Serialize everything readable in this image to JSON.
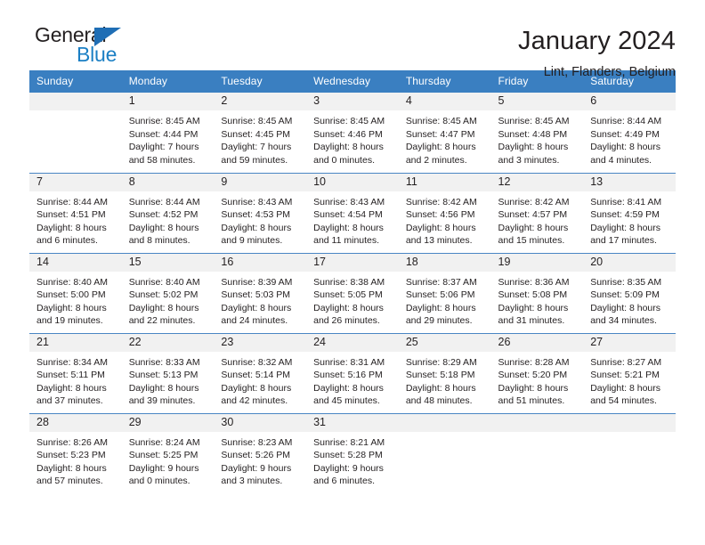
{
  "brand": {
    "name_top": "General",
    "name_bottom": "Blue",
    "flag_icon": "blue-triangle-flag-icon",
    "color_primary": "#1f6eb5",
    "color_secondary": "#1b7fc4"
  },
  "header": {
    "title": "January 2024",
    "subtitle": "Lint, Flanders, Belgium"
  },
  "calendar": {
    "header_bg": "#3a7fc1",
    "daynum_bg": "#f1f1f1",
    "row_divider": "#4a86c4",
    "weekdays": [
      "Sunday",
      "Monday",
      "Tuesday",
      "Wednesday",
      "Thursday",
      "Friday",
      "Saturday"
    ],
    "weeks": [
      [
        {
          "day": "",
          "lines": []
        },
        {
          "day": "1",
          "lines": [
            "Sunrise: 8:45 AM",
            "Sunset: 4:44 PM",
            "Daylight: 7 hours",
            "and 58 minutes."
          ]
        },
        {
          "day": "2",
          "lines": [
            "Sunrise: 8:45 AM",
            "Sunset: 4:45 PM",
            "Daylight: 7 hours",
            "and 59 minutes."
          ]
        },
        {
          "day": "3",
          "lines": [
            "Sunrise: 8:45 AM",
            "Sunset: 4:46 PM",
            "Daylight: 8 hours",
            "and 0 minutes."
          ]
        },
        {
          "day": "4",
          "lines": [
            "Sunrise: 8:45 AM",
            "Sunset: 4:47 PM",
            "Daylight: 8 hours",
            "and 2 minutes."
          ]
        },
        {
          "day": "5",
          "lines": [
            "Sunrise: 8:45 AM",
            "Sunset: 4:48 PM",
            "Daylight: 8 hours",
            "and 3 minutes."
          ]
        },
        {
          "day": "6",
          "lines": [
            "Sunrise: 8:44 AM",
            "Sunset: 4:49 PM",
            "Daylight: 8 hours",
            "and 4 minutes."
          ]
        }
      ],
      [
        {
          "day": "7",
          "lines": [
            "Sunrise: 8:44 AM",
            "Sunset: 4:51 PM",
            "Daylight: 8 hours",
            "and 6 minutes."
          ]
        },
        {
          "day": "8",
          "lines": [
            "Sunrise: 8:44 AM",
            "Sunset: 4:52 PM",
            "Daylight: 8 hours",
            "and 8 minutes."
          ]
        },
        {
          "day": "9",
          "lines": [
            "Sunrise: 8:43 AM",
            "Sunset: 4:53 PM",
            "Daylight: 8 hours",
            "and 9 minutes."
          ]
        },
        {
          "day": "10",
          "lines": [
            "Sunrise: 8:43 AM",
            "Sunset: 4:54 PM",
            "Daylight: 8 hours",
            "and 11 minutes."
          ]
        },
        {
          "day": "11",
          "lines": [
            "Sunrise: 8:42 AM",
            "Sunset: 4:56 PM",
            "Daylight: 8 hours",
            "and 13 minutes."
          ]
        },
        {
          "day": "12",
          "lines": [
            "Sunrise: 8:42 AM",
            "Sunset: 4:57 PM",
            "Daylight: 8 hours",
            "and 15 minutes."
          ]
        },
        {
          "day": "13",
          "lines": [
            "Sunrise: 8:41 AM",
            "Sunset: 4:59 PM",
            "Daylight: 8 hours",
            "and 17 minutes."
          ]
        }
      ],
      [
        {
          "day": "14",
          "lines": [
            "Sunrise: 8:40 AM",
            "Sunset: 5:00 PM",
            "Daylight: 8 hours",
            "and 19 minutes."
          ]
        },
        {
          "day": "15",
          "lines": [
            "Sunrise: 8:40 AM",
            "Sunset: 5:02 PM",
            "Daylight: 8 hours",
            "and 22 minutes."
          ]
        },
        {
          "day": "16",
          "lines": [
            "Sunrise: 8:39 AM",
            "Sunset: 5:03 PM",
            "Daylight: 8 hours",
            "and 24 minutes."
          ]
        },
        {
          "day": "17",
          "lines": [
            "Sunrise: 8:38 AM",
            "Sunset: 5:05 PM",
            "Daylight: 8 hours",
            "and 26 minutes."
          ]
        },
        {
          "day": "18",
          "lines": [
            "Sunrise: 8:37 AM",
            "Sunset: 5:06 PM",
            "Daylight: 8 hours",
            "and 29 minutes."
          ]
        },
        {
          "day": "19",
          "lines": [
            "Sunrise: 8:36 AM",
            "Sunset: 5:08 PM",
            "Daylight: 8 hours",
            "and 31 minutes."
          ]
        },
        {
          "day": "20",
          "lines": [
            "Sunrise: 8:35 AM",
            "Sunset: 5:09 PM",
            "Daylight: 8 hours",
            "and 34 minutes."
          ]
        }
      ],
      [
        {
          "day": "21",
          "lines": [
            "Sunrise: 8:34 AM",
            "Sunset: 5:11 PM",
            "Daylight: 8 hours",
            "and 37 minutes."
          ]
        },
        {
          "day": "22",
          "lines": [
            "Sunrise: 8:33 AM",
            "Sunset: 5:13 PM",
            "Daylight: 8 hours",
            "and 39 minutes."
          ]
        },
        {
          "day": "23",
          "lines": [
            "Sunrise: 8:32 AM",
            "Sunset: 5:14 PM",
            "Daylight: 8 hours",
            "and 42 minutes."
          ]
        },
        {
          "day": "24",
          "lines": [
            "Sunrise: 8:31 AM",
            "Sunset: 5:16 PM",
            "Daylight: 8 hours",
            "and 45 minutes."
          ]
        },
        {
          "day": "25",
          "lines": [
            "Sunrise: 8:29 AM",
            "Sunset: 5:18 PM",
            "Daylight: 8 hours",
            "and 48 minutes."
          ]
        },
        {
          "day": "26",
          "lines": [
            "Sunrise: 8:28 AM",
            "Sunset: 5:20 PM",
            "Daylight: 8 hours",
            "and 51 minutes."
          ]
        },
        {
          "day": "27",
          "lines": [
            "Sunrise: 8:27 AM",
            "Sunset: 5:21 PM",
            "Daylight: 8 hours",
            "and 54 minutes."
          ]
        }
      ],
      [
        {
          "day": "28",
          "lines": [
            "Sunrise: 8:26 AM",
            "Sunset: 5:23 PM",
            "Daylight: 8 hours",
            "and 57 minutes."
          ]
        },
        {
          "day": "29",
          "lines": [
            "Sunrise: 8:24 AM",
            "Sunset: 5:25 PM",
            "Daylight: 9 hours",
            "and 0 minutes."
          ]
        },
        {
          "day": "30",
          "lines": [
            "Sunrise: 8:23 AM",
            "Sunset: 5:26 PM",
            "Daylight: 9 hours",
            "and 3 minutes."
          ]
        },
        {
          "day": "31",
          "lines": [
            "Sunrise: 8:21 AM",
            "Sunset: 5:28 PM",
            "Daylight: 9 hours",
            "and 6 minutes."
          ]
        },
        {
          "day": "",
          "lines": []
        },
        {
          "day": "",
          "lines": []
        },
        {
          "day": "",
          "lines": []
        }
      ]
    ]
  }
}
